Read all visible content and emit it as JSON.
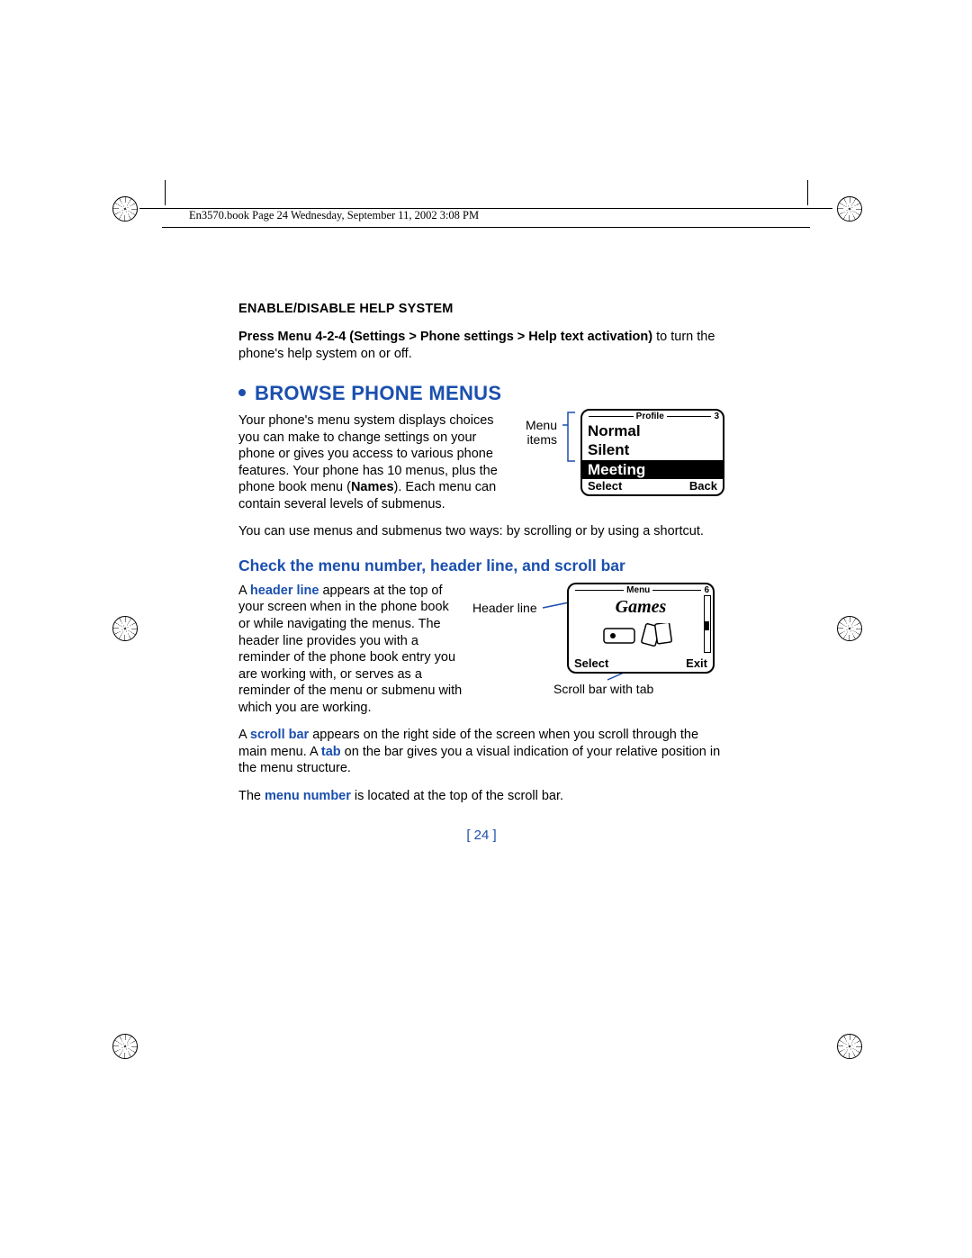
{
  "book_header": "En3570.book  Page 24  Wednesday, September 11, 2002  3:08 PM",
  "subhead": "ENABLE/DISABLE HELP SYSTEM",
  "p1_bold": "Press Menu 4-2-4 (Settings > Phone settings > Help text activation)",
  "p1_rest": " to turn the phone's help system on or off.",
  "section_title": "BROWSE PHONE MENUS",
  "p2": "Your phone's menu system displays choices you can make to change settings on your phone or gives you access to various phone features. Your phone has 10 menus, plus the phone book menu (",
  "p2_bold": "Names",
  "p2_end": "). Each menu can contain several levels of submenus.",
  "p3": "You can use menus and submenus two ways: by scrolling or by using a shortcut.",
  "subsection": "Check the menu number, header line, and scroll bar",
  "p4_a": "A ",
  "p4_t1": "header line",
  "p4_b": " appears at the top of your screen when in the phone book or while navigating the menus. The header line provides you with a reminder of the phone book entry you are working with, or serves as a reminder of the menu or submenu with which you are working.",
  "p5_a": "A ",
  "p5_t1": "scroll bar",
  "p5_b": " appears on the right side of the screen when you scroll through the main menu. A ",
  "p5_t2": "tab",
  "p5_c": " on the bar gives you a visual indication of your relative position in the menu structure.",
  "p6_a": "The ",
  "p6_t1": "menu number",
  "p6_b": " is located at the top of the scroll bar.",
  "page_number": "[ 24 ]",
  "fig1": {
    "label": "Menu items",
    "header": "Profile",
    "header_num": "3",
    "items": [
      "Normal",
      "Silent",
      "Meeting"
    ],
    "selected_index": 2,
    "soft_left": "Select",
    "soft_right": "Back"
  },
  "fig2": {
    "label_header": "Header line",
    "label_scroll": "Scroll bar with tab",
    "header": "Menu",
    "header_num": "6",
    "title": "Games",
    "soft_left": "Select",
    "soft_right": "Exit"
  }
}
